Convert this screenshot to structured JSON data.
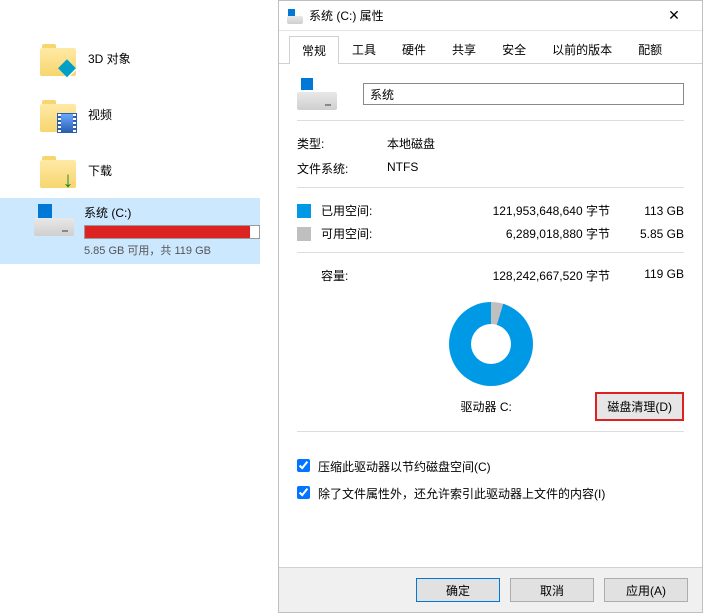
{
  "explorer": {
    "items": [
      {
        "label": "3D 对象"
      },
      {
        "label": "视频"
      },
      {
        "label": "下载"
      }
    ],
    "drive": {
      "name": "系统 (C:)",
      "subtext": "5.85 GB 可用，共 119 GB"
    }
  },
  "dialog": {
    "title": "系统 (C:) 属性",
    "tabs": [
      "常规",
      "工具",
      "硬件",
      "共享",
      "安全",
      "以前的版本",
      "配额"
    ],
    "name_value": "系统",
    "type_label": "类型:",
    "type_value": "本地磁盘",
    "fs_label": "文件系统:",
    "fs_value": "NTFS",
    "used_label": "已用空间:",
    "used_bytes": "121,953,648,640 字节",
    "used_human": "113 GB",
    "free_label": "可用空间:",
    "free_bytes": "6,289,018,880 字节",
    "free_human": "5.85 GB",
    "cap_label": "容量:",
    "cap_bytes": "128,242,667,520 字节",
    "cap_human": "119 GB",
    "drive_label": "驱动器 C:",
    "cleanup_btn": "磁盘清理(D)",
    "check1": "压缩此驱动器以节约磁盘空间(C)",
    "check2": "除了文件属性外，还允许索引此驱动器上文件的内容(I)",
    "ok": "确定",
    "cancel": "取消",
    "apply": "应用(A)"
  }
}
